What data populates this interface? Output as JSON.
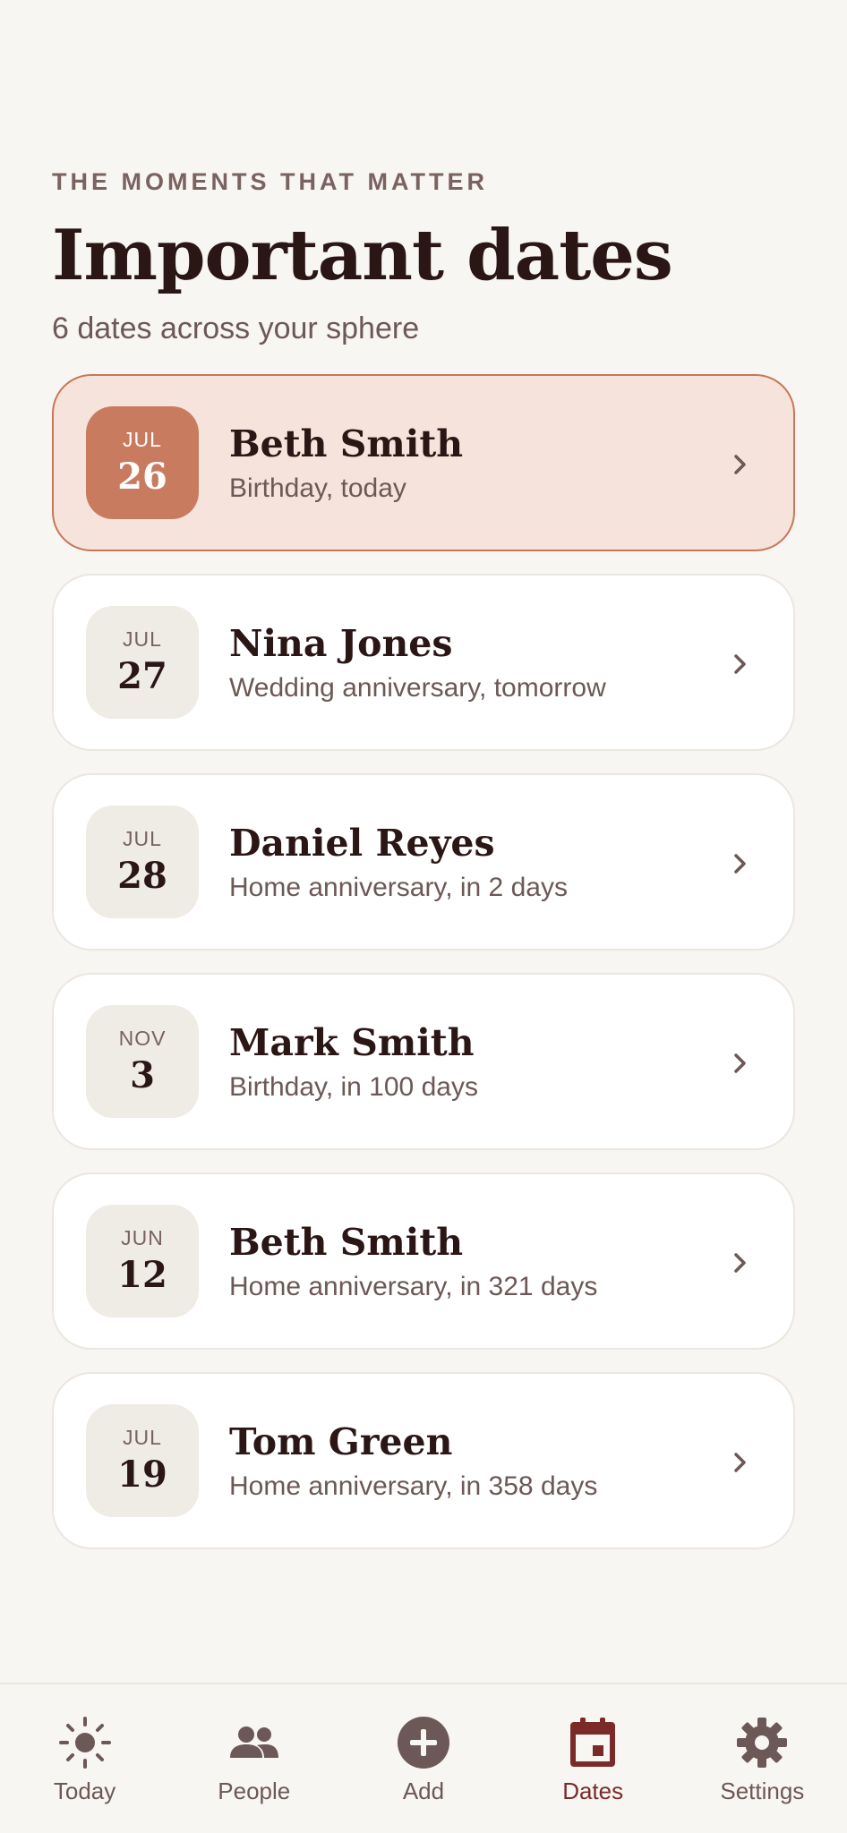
{
  "header": {
    "eyebrow": "THE MOMENTS THAT MATTER",
    "title": "Important dates",
    "subtitle": "6 dates across your sphere"
  },
  "dates": [
    {
      "month": "JUL",
      "day": "26",
      "name": "Beth Smith",
      "detail": "Birthday, today",
      "highlight": true
    },
    {
      "month": "JUL",
      "day": "27",
      "name": "Nina Jones",
      "detail": "Wedding anniversary, tomorrow",
      "highlight": false
    },
    {
      "month": "JUL",
      "day": "28",
      "name": "Daniel Reyes",
      "detail": "Home anniversary, in 2 days",
      "highlight": false
    },
    {
      "month": "NOV",
      "day": "3",
      "name": "Mark Smith",
      "detail": "Birthday, in 100 days",
      "highlight": false
    },
    {
      "month": "JUN",
      "day": "12",
      "name": "Beth Smith",
      "detail": "Home anniversary, in 321 days",
      "highlight": false
    },
    {
      "month": "JUL",
      "day": "19",
      "name": "Tom Green",
      "detail": "Home anniversary, in 358 days",
      "highlight": false
    }
  ],
  "tabbar": {
    "tabs": [
      {
        "label": "Today",
        "icon": "sun-icon"
      },
      {
        "label": "People",
        "icon": "people-icon"
      },
      {
        "label": "Add",
        "icon": "add-circle-icon"
      },
      {
        "label": "Dates",
        "icon": "calendar-icon",
        "active": true
      },
      {
        "label": "Settings",
        "icon": "gear-icon"
      }
    ]
  },
  "colors": {
    "background": "#f8f6f2",
    "accent": "#c97b5f",
    "active_tab": "#7b2a2a",
    "text": "#2b1616"
  }
}
